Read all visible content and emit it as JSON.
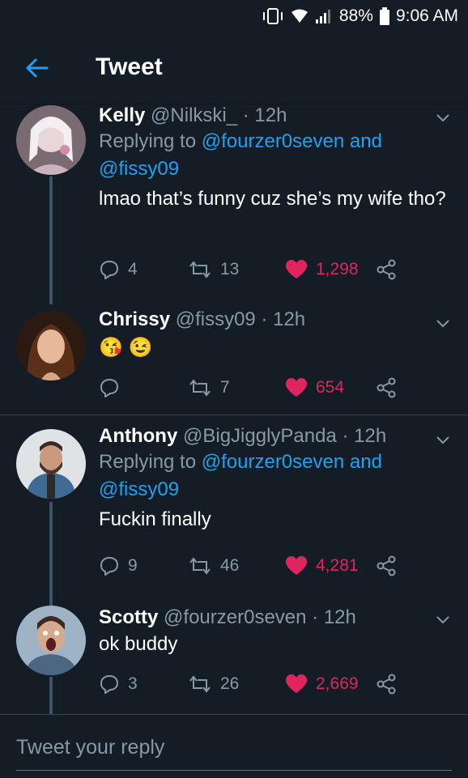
{
  "status_bar": {
    "battery": "88%",
    "time": "9:06 AM"
  },
  "app_bar": {
    "title": "Tweet"
  },
  "tweets": [
    {
      "name": "Kelly",
      "handle": "@Nilkski_",
      "time": "· 12h",
      "replying_prefix": "Replying to",
      "replying_to_1": "@fourzer0seven",
      "replying_and": "and",
      "replying_to_2": "@fissy09",
      "text": "lmao that’s funny cuz she’s my wife tho?",
      "replies": "4",
      "retweets": "13",
      "likes": "1,298"
    },
    {
      "name": "Chrissy",
      "handle": "@fissy09",
      "time": "· 12h",
      "text": "😘 😉",
      "replies": "",
      "retweets": "7",
      "likes": "654"
    },
    {
      "name": "Anthony",
      "handle": "@BigJigglyPanda",
      "time": "· 12h",
      "replying_prefix": "Replying to",
      "replying_to_1": "@fourzer0seven",
      "replying_and": "and",
      "replying_to_2": "@fissy09",
      "text": "Fuckin finally",
      "replies": "9",
      "retweets": "46",
      "likes": "4,281"
    },
    {
      "name": "Scotty",
      "handle": "@fourzer0seven",
      "time": "· 12h",
      "text": "ok buddy",
      "replies": "3",
      "retweets": "26",
      "likes": "2,669"
    }
  ],
  "reply_box": {
    "placeholder": "Tweet your reply"
  },
  "colors": {
    "background": "#141d26",
    "accent": "#1da1f2",
    "like": "#e0245e",
    "muted": "#8899a6"
  }
}
